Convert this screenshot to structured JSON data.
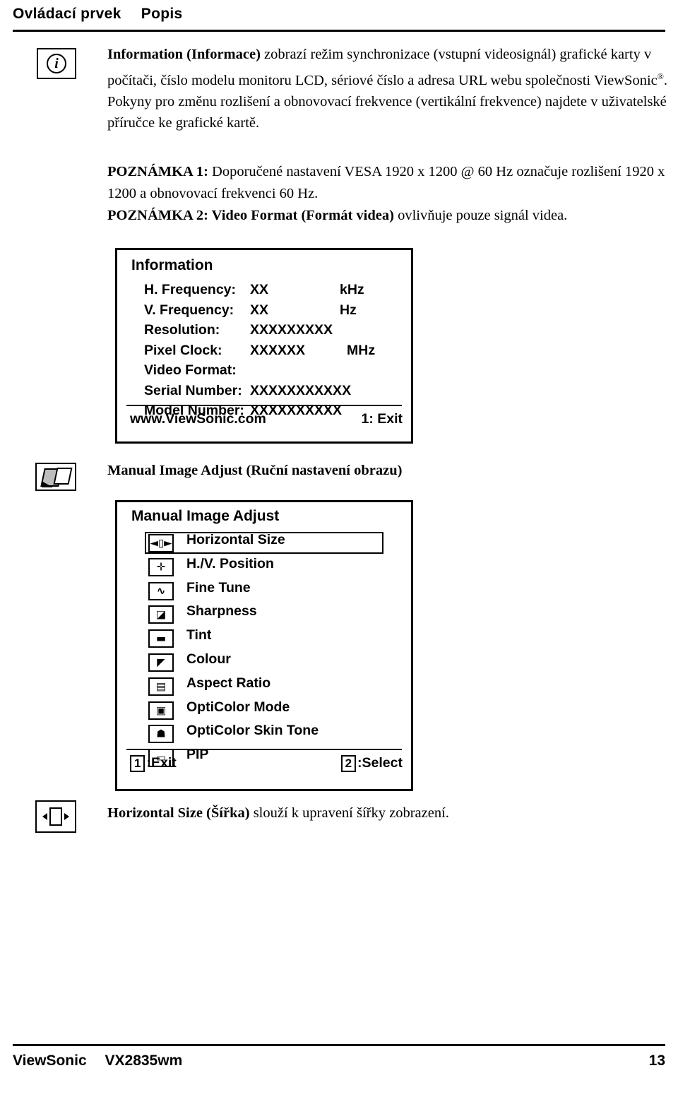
{
  "header": {
    "col1": "Ovládací prvek",
    "col2": "Popis"
  },
  "info_section": {
    "icon_name": "information-icon",
    "icon_glyph": "i",
    "paragraph_html": "Information (Informace) zobrazí režim synchronizace (vstupní videosignál) grafické karty v počítači, číslo modelu monitoru LCD, sériové číslo a adresa URL webu společnosti ViewSonic. Pokyny pro změnu rozlišení a obnovovací frekvence (vertikální frekvence) najdete v uživatelské příručce ke grafické kartě.",
    "bold_lead": "Information (Informace)",
    "rest": " zobrazí režim synchronizace (vstupní videosignál) grafické karty v počítači, číslo modelu monitoru LCD, sériové číslo a adresa URL webu společnosti ViewSonic",
    "reg_mark": "®",
    "rest2": ". Pokyny pro změnu rozlišení a obnovovací frekvence (vertikální frekvence) najdete v uživatelské příručce ke grafické kartě.",
    "note1_label": "POZNÁMKA 1:",
    "note1_text": " Doporučené nastavení VESA 1920 x 1200 @ 60 Hz označuje rozlišení 1920 x 1200 a obnovovací frekvenci 60 Hz.",
    "note2_label": "POZNÁMKA 2: Video Format (Formát videa)",
    "note2_text": " ovlivňuje pouze signál videa."
  },
  "osd_information": {
    "title": "Information",
    "rows": [
      {
        "label": "H. Frequency:",
        "value": "XX",
        "unit": "kHz"
      },
      {
        "label": "V. Frequency:",
        "value": "XX",
        "unit": "Hz"
      },
      {
        "label": "Resolution:",
        "value": "XXXXXXXXX",
        "unit": ""
      },
      {
        "label": "Pixel Clock:",
        "value": "XXXXXX",
        "unit": "MHz"
      },
      {
        "label": "Video Format:",
        "value": "",
        "unit": ""
      },
      {
        "label": "Serial Number:",
        "value": "XXXXXXXXXXX",
        "unit": ""
      },
      {
        "label": "Model Number:",
        "value": "XXXXXXXXXX",
        "unit": ""
      }
    ],
    "footer_url": "www.ViewSonic.com",
    "footer_exit": "1: Exit"
  },
  "manual_image_adjust": {
    "heading": "Manual Image Adjust (Ruční nastavení obrazu)",
    "icon_name": "manual-image-adjust-icon",
    "osd_title": "Manual Image Adjust",
    "items": [
      {
        "label": "Horizontal Size",
        "icon": "horizontal-size-icon",
        "selected": true
      },
      {
        "label": "H./V. Position",
        "icon": "hv-position-icon",
        "selected": false
      },
      {
        "label": "Fine Tune",
        "icon": "fine-tune-icon",
        "selected": false
      },
      {
        "label": "Sharpness",
        "icon": "sharpness-icon",
        "selected": false
      },
      {
        "label": "Tint",
        "icon": "tint-icon",
        "selected": false
      },
      {
        "label": "Colour",
        "icon": "colour-icon",
        "selected": false
      },
      {
        "label": "Aspect Ratio",
        "icon": "aspect-ratio-icon",
        "selected": false
      },
      {
        "label": "OptiColor Mode",
        "icon": "opticolor-mode-icon",
        "selected": false
      },
      {
        "label": "OptiColor Skin Tone",
        "icon": "opticolor-skin-tone-icon",
        "selected": false
      },
      {
        "label": "PIP",
        "icon": "pip-icon",
        "selected": false
      }
    ],
    "footer_exit_key": "1",
    "footer_exit_label": ":Exit",
    "footer_select_key": "2",
    "footer_select_label": ":Select"
  },
  "horizontal_size_section": {
    "icon_name": "horizontal-size-icon",
    "bold": "Horizontal Size (Šířka)",
    "text": " slouží k upravení šířky zobrazení."
  },
  "page_footer": {
    "brand": "ViewSonic",
    "model": "VX2835wm",
    "page_number": "13"
  }
}
